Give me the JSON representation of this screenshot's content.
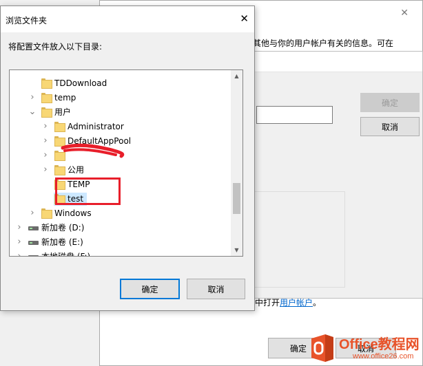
{
  "background_profile_dialog": {
    "description_partial": "其他与你的用户帐户有关的信息。可在",
    "link_prefix": "中打开",
    "link_text": "用户帐户",
    "link_suffix": "。",
    "ok_label": "确定",
    "cancel_label": "取消"
  },
  "background_edit_dialog": {
    "ok_label": "确定",
    "cancel_label": "取消"
  },
  "browse_dialog": {
    "title": "浏览文件夹",
    "prompt": "将配置文件放入以下目录:",
    "ok_label": "确定",
    "cancel_label": "取消",
    "tree": [
      {
        "label": "TDDownload",
        "depth": 2,
        "chevron": "none",
        "icon": "folder-icon"
      },
      {
        "label": "temp",
        "depth": 2,
        "chevron": "collapsed",
        "icon": "folder-icon"
      },
      {
        "label": "用户",
        "depth": 2,
        "chevron": "expanded",
        "icon": "folder-icon"
      },
      {
        "label": "Administrator",
        "depth": 3,
        "chevron": "collapsed",
        "icon": "folder-icon"
      },
      {
        "label": "DefaultAppPool",
        "depth": 3,
        "chevron": "collapsed",
        "icon": "folder-icon"
      },
      {
        "label": "",
        "depth": 3,
        "chevron": "collapsed",
        "icon": "folder-icon"
      },
      {
        "label": "公用",
        "depth": 3,
        "chevron": "collapsed",
        "icon": "folder-icon"
      },
      {
        "label": "TEMP",
        "depth": 3,
        "chevron": "none",
        "icon": "folder-icon"
      },
      {
        "label": "test",
        "depth": 3,
        "chevron": "none",
        "icon": "folder-icon",
        "selected": true
      },
      {
        "label": "Windows",
        "depth": 2,
        "chevron": "collapsed",
        "icon": "folder-icon"
      },
      {
        "label": "新加卷 (D:)",
        "depth": 1,
        "chevron": "collapsed",
        "icon": "drive-icon"
      },
      {
        "label": "新加卷 (E:)",
        "depth": 1,
        "chevron": "collapsed",
        "icon": "drive-icon"
      },
      {
        "label": "本地磁盘 (F:)",
        "depth": 1,
        "chevron": "collapsed",
        "icon": "drive-icon"
      }
    ]
  },
  "watermark": {
    "brand": "Office教程网",
    "site": "www.office26.com"
  },
  "colors": {
    "accent": "#0078d7",
    "highlight_box": "#e81e2a",
    "selection": "#cce8ff",
    "link": "#0066cc",
    "watermark": "#e8532a"
  }
}
